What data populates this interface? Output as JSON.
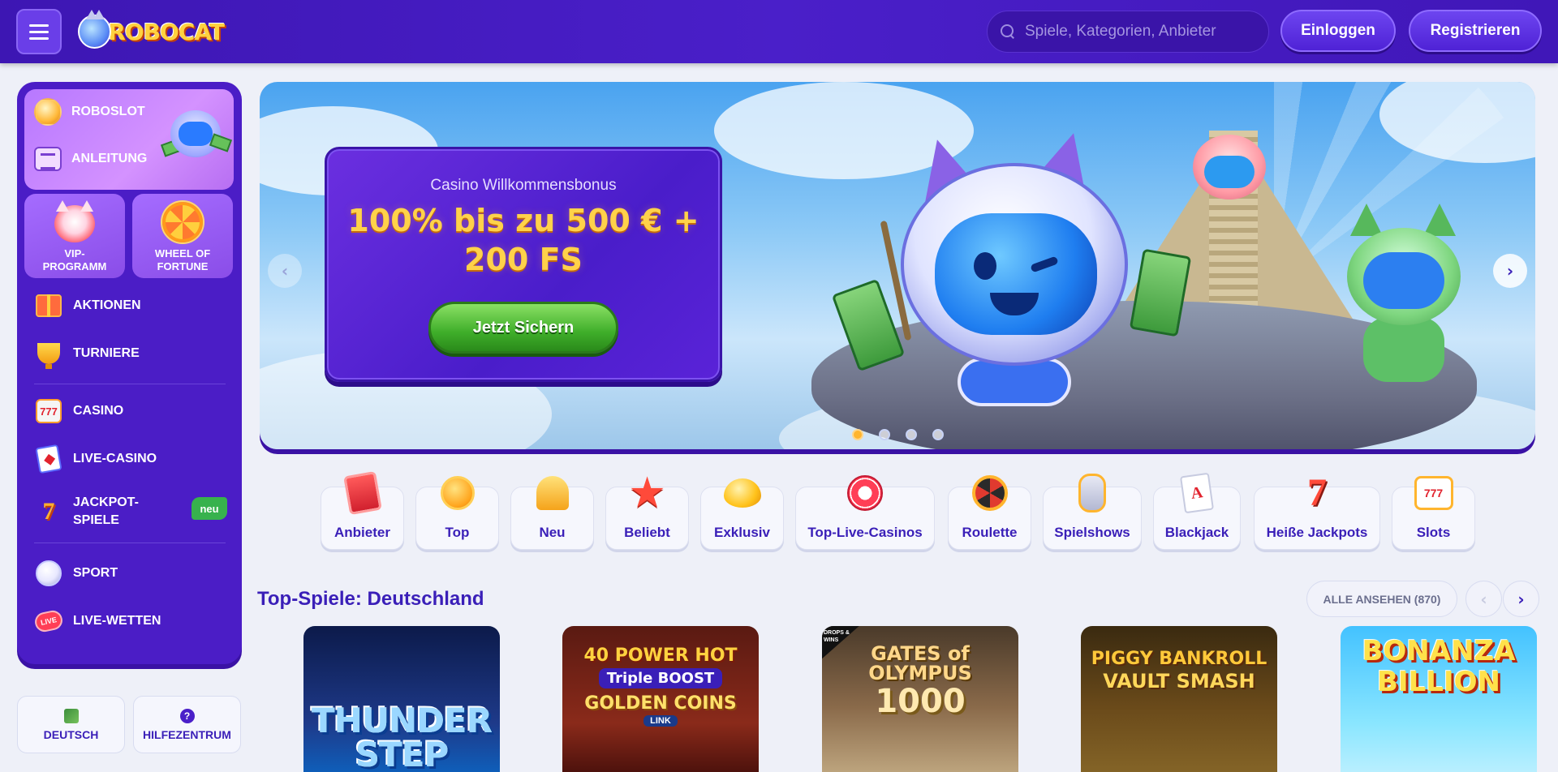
{
  "header": {
    "logo_text": "ROBOCAT",
    "search_placeholder": "Spiele, Kategorien, Anbieter",
    "login_label": "Einloggen",
    "register_label": "Registrieren"
  },
  "sidebar": {
    "promo": [
      {
        "label": "ROBOSLOT",
        "icon": "coin-icon"
      },
      {
        "label": "ANLEITUNG",
        "icon": "guide-icon"
      }
    ],
    "tiles": [
      {
        "label": "VIP-PROGRAMM",
        "icon": "vip-cat-icon"
      },
      {
        "label": "WHEEL OF FORTUNE",
        "icon": "wheel-icon"
      }
    ],
    "items": [
      {
        "label": "AKTIONEN",
        "icon": "gift-icon"
      },
      {
        "label": "TURNIERE",
        "icon": "trophy-icon"
      },
      {
        "label": "CASINO",
        "icon": "slot-machine-icon"
      },
      {
        "label": "LIVE-CASINO",
        "icon": "cards-icon"
      },
      {
        "label": "JACKPOT-SPIELE",
        "icon": "seven-icon",
        "badge": "neu"
      },
      {
        "label": "SPORT",
        "icon": "ball-icon"
      },
      {
        "label": "LIVE-WETTEN",
        "icon": "live-icon"
      }
    ],
    "bottom": [
      {
        "label": "DEUTSCH",
        "icon": "globe-icon"
      },
      {
        "label": "HILFEZENTRUM",
        "icon": "help-icon"
      }
    ]
  },
  "hero": {
    "subtitle": "Casino Willkommensbonus",
    "title": "100% bis zu 500 € + 200 FS",
    "cta": "Jetzt Sichern",
    "slides_total": 4,
    "active_slide": 1,
    "prev_arrow": "‹",
    "next_arrow": "›"
  },
  "categories": [
    {
      "label": "Anbieter",
      "icon": "book-icon"
    },
    {
      "label": "Top",
      "icon": "medal-icon"
    },
    {
      "label": "Neu",
      "icon": "bell-icon"
    },
    {
      "label": "Beliebt",
      "icon": "star-icon"
    },
    {
      "label": "Exklusiv",
      "icon": "gem-icon"
    },
    {
      "label": "Top-Live-Casinos",
      "icon": "chip-icon"
    },
    {
      "label": "Roulette",
      "icon": "roulette-icon"
    },
    {
      "label": "Spielshows",
      "icon": "mic-icon"
    },
    {
      "label": "Blackjack",
      "icon": "ace-card-icon"
    },
    {
      "label": "Heiße Jackpots",
      "icon": "seven-icon"
    },
    {
      "label": "Slots",
      "icon": "slot-icon"
    }
  ],
  "top_games": {
    "title": "Top-Spiele: Deutschland",
    "see_all": "ALLE ANSEHEN (870)",
    "games": [
      {
        "title": "THUNDER STEP"
      },
      {
        "title": "40 POWER HOT",
        "sub": "Triple BOOST",
        "sub2": "GOLDEN COINS",
        "sub3": "LINK"
      },
      {
        "title": "GATES of OLYMPUS",
        "num": "1000",
        "ribbon": "DROPS & WINS"
      },
      {
        "title": "PIGGY BANKROLL",
        "sub": "VAULT SMASH"
      },
      {
        "title": "BONANZA BILLION"
      }
    ]
  },
  "colors": {
    "brand_purple": "#4a1fc9",
    "accent_gold": "#ffd24a",
    "cta_green": "#3fae2a",
    "badge_green": "#37b24d"
  }
}
